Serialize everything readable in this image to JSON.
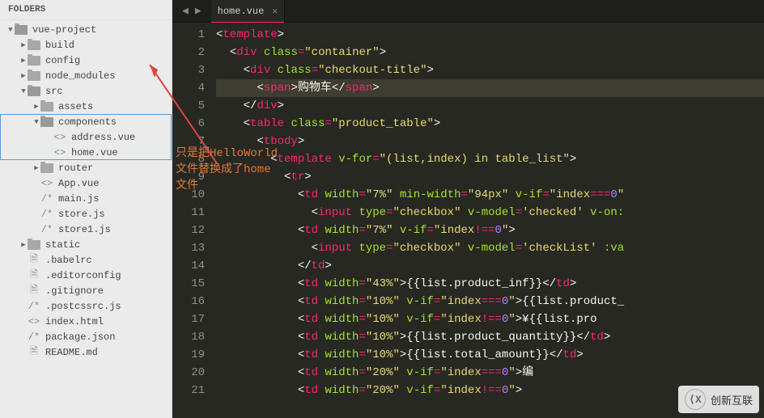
{
  "sidebar": {
    "title": "FOLDERS",
    "tree": [
      {
        "depth": 0,
        "arrow": "▼",
        "icon": "folder-open",
        "label": "vue-project"
      },
      {
        "depth": 1,
        "arrow": "▶",
        "icon": "folder",
        "label": "build"
      },
      {
        "depth": 1,
        "arrow": "▶",
        "icon": "folder",
        "label": "config"
      },
      {
        "depth": 1,
        "arrow": "▶",
        "icon": "folder",
        "label": "node_modules"
      },
      {
        "depth": 1,
        "arrow": "▼",
        "icon": "folder-open",
        "label": "src"
      },
      {
        "depth": 2,
        "arrow": "▶",
        "icon": "folder",
        "label": "assets"
      },
      {
        "depth": 2,
        "arrow": "▼",
        "icon": "folder-open",
        "label": "components",
        "hl": true
      },
      {
        "depth": 3,
        "arrow": "",
        "icon": "code",
        "label": "address.vue",
        "hl": true
      },
      {
        "depth": 3,
        "arrow": "",
        "icon": "code",
        "label": "home.vue",
        "hl": true
      },
      {
        "depth": 2,
        "arrow": "▶",
        "icon": "folder",
        "label": "router"
      },
      {
        "depth": 2,
        "arrow": "",
        "icon": "code",
        "label": "App.vue"
      },
      {
        "depth": 2,
        "arrow": "",
        "icon": "js",
        "label": "main.js"
      },
      {
        "depth": 2,
        "arrow": "",
        "icon": "js",
        "label": "store.js"
      },
      {
        "depth": 2,
        "arrow": "",
        "icon": "js",
        "label": "store1.js"
      },
      {
        "depth": 1,
        "arrow": "▶",
        "icon": "folder",
        "label": "static"
      },
      {
        "depth": 1,
        "arrow": "",
        "icon": "file",
        "label": ".babelrc"
      },
      {
        "depth": 1,
        "arrow": "",
        "icon": "file",
        "label": ".editorconfig"
      },
      {
        "depth": 1,
        "arrow": "",
        "icon": "file",
        "label": ".gitignore"
      },
      {
        "depth": 1,
        "arrow": "",
        "icon": "js",
        "label": ".postcssrc.js"
      },
      {
        "depth": 1,
        "arrow": "",
        "icon": "code",
        "label": "index.html"
      },
      {
        "depth": 1,
        "arrow": "",
        "icon": "js",
        "label": "package.json"
      },
      {
        "depth": 1,
        "arrow": "",
        "icon": "file",
        "label": "README.md"
      }
    ]
  },
  "tab": {
    "name": "home.vue"
  },
  "annotation": {
    "line1": "只是把HelloWorld",
    "line2": "文件替换成了home",
    "line3": "文件"
  },
  "code": {
    "lines": [
      [
        [
          "br",
          "<"
        ],
        [
          "tag",
          "template"
        ],
        [
          "br",
          ">"
        ]
      ],
      [
        [
          "pl",
          "  "
        ],
        [
          "br",
          "<"
        ],
        [
          "tag",
          "div"
        ],
        [
          "pl",
          " "
        ],
        [
          "attr",
          "class"
        ],
        [
          "op",
          "="
        ],
        [
          "str",
          "\"container\""
        ],
        [
          "br",
          ">"
        ]
      ],
      [
        [
          "pl",
          "    "
        ],
        [
          "br",
          "<"
        ],
        [
          "tag",
          "div"
        ],
        [
          "pl",
          " "
        ],
        [
          "attr",
          "class"
        ],
        [
          "op",
          "="
        ],
        [
          "str",
          "\"checkout-title\""
        ],
        [
          "br",
          ">"
        ]
      ],
      [
        [
          "pl",
          "      "
        ],
        [
          "br",
          "<"
        ],
        [
          "tag",
          "span"
        ],
        [
          "br",
          ">"
        ],
        [
          "pl",
          "购物车"
        ],
        [
          "br",
          "</"
        ],
        [
          "tag",
          "span"
        ],
        [
          "br",
          ">"
        ]
      ],
      [
        [
          "pl",
          "    "
        ],
        [
          "br",
          "</"
        ],
        [
          "tag",
          "div"
        ],
        [
          "br",
          ">"
        ]
      ],
      [
        [
          "pl",
          "    "
        ],
        [
          "br",
          "<"
        ],
        [
          "tag",
          "table"
        ],
        [
          "pl",
          " "
        ],
        [
          "attr",
          "class"
        ],
        [
          "op",
          "="
        ],
        [
          "str",
          "\"product_table\""
        ],
        [
          "br",
          ">"
        ]
      ],
      [
        [
          "pl",
          "      "
        ],
        [
          "br",
          "<"
        ],
        [
          "tag",
          "tbody"
        ],
        [
          "br",
          ">"
        ]
      ],
      [
        [
          "pl",
          "        "
        ],
        [
          "br",
          "<"
        ],
        [
          "tag",
          "template"
        ],
        [
          "pl",
          " "
        ],
        [
          "attr",
          "v-for"
        ],
        [
          "op",
          "="
        ],
        [
          "str",
          "\"(list,index) in table_list\""
        ],
        [
          "br",
          ">"
        ]
      ],
      [
        [
          "pl",
          "          "
        ],
        [
          "br",
          "<"
        ],
        [
          "tag",
          "tr"
        ],
        [
          "br",
          ">"
        ]
      ],
      [
        [
          "pl",
          "            "
        ],
        [
          "br",
          "<"
        ],
        [
          "tag",
          "td"
        ],
        [
          "pl",
          " "
        ],
        [
          "attr",
          "width"
        ],
        [
          "op",
          "="
        ],
        [
          "str",
          "\"7%\""
        ],
        [
          "pl",
          " "
        ],
        [
          "attr",
          "min-width"
        ],
        [
          "op",
          "="
        ],
        [
          "str",
          "\"94px\""
        ],
        [
          "pl",
          " "
        ],
        [
          "attr",
          "v-if"
        ],
        [
          "op",
          "="
        ],
        [
          "str",
          "\"index"
        ],
        [
          "op",
          "==="
        ],
        [
          "num",
          "0"
        ],
        [
          "str",
          "\""
        ]
      ],
      [
        [
          "pl",
          "              "
        ],
        [
          "br",
          "<"
        ],
        [
          "tag",
          "input"
        ],
        [
          "pl",
          " "
        ],
        [
          "attr",
          "type"
        ],
        [
          "op",
          "="
        ],
        [
          "str",
          "\"checkbox\""
        ],
        [
          "pl",
          " "
        ],
        [
          "attr",
          "v-model"
        ],
        [
          "op",
          "="
        ],
        [
          "str",
          "'checked'"
        ],
        [
          "pl",
          " "
        ],
        [
          "attr",
          "v-on:"
        ]
      ],
      [
        [
          "pl",
          "            "
        ],
        [
          "br",
          "<"
        ],
        [
          "tag",
          "td"
        ],
        [
          "pl",
          " "
        ],
        [
          "attr",
          "width"
        ],
        [
          "op",
          "="
        ],
        [
          "str",
          "\"7%\""
        ],
        [
          "pl",
          " "
        ],
        [
          "attr",
          "v-if"
        ],
        [
          "op",
          "="
        ],
        [
          "str",
          "\"index"
        ],
        [
          "op",
          "!=="
        ],
        [
          "num",
          "0"
        ],
        [
          "str",
          "\""
        ],
        [
          "br",
          ">"
        ]
      ],
      [
        [
          "pl",
          "              "
        ],
        [
          "br",
          "<"
        ],
        [
          "tag",
          "input"
        ],
        [
          "pl",
          " "
        ],
        [
          "attr",
          "type"
        ],
        [
          "op",
          "="
        ],
        [
          "str",
          "\"checkbox\""
        ],
        [
          "pl",
          " "
        ],
        [
          "attr",
          "v-model"
        ],
        [
          "op",
          "="
        ],
        [
          "str",
          "'checkList'"
        ],
        [
          "pl",
          " "
        ],
        [
          "attr",
          ":va"
        ]
      ],
      [
        [
          "pl",
          "            "
        ],
        [
          "br",
          "</"
        ],
        [
          "tag",
          "td"
        ],
        [
          "br",
          ">"
        ]
      ],
      [
        [
          "pl",
          "            "
        ],
        [
          "br",
          "<"
        ],
        [
          "tag",
          "td"
        ],
        [
          "pl",
          " "
        ],
        [
          "attr",
          "width"
        ],
        [
          "op",
          "="
        ],
        [
          "str",
          "\"43%\""
        ],
        [
          "br",
          ">"
        ],
        [
          "pl",
          "{{list.product_inf}}"
        ],
        [
          "br",
          "</"
        ],
        [
          "tag",
          "td"
        ],
        [
          "br",
          ">"
        ]
      ],
      [
        [
          "pl",
          "            "
        ],
        [
          "br",
          "<"
        ],
        [
          "tag",
          "td"
        ],
        [
          "pl",
          " "
        ],
        [
          "attr",
          "width"
        ],
        [
          "op",
          "="
        ],
        [
          "str",
          "\"10%\""
        ],
        [
          "pl",
          " "
        ],
        [
          "attr",
          "v-if"
        ],
        [
          "op",
          "="
        ],
        [
          "str",
          "\"index"
        ],
        [
          "op",
          "==="
        ],
        [
          "num",
          "0"
        ],
        [
          "str",
          "\""
        ],
        [
          "br",
          ">"
        ],
        [
          "pl",
          "{{list.product_"
        ]
      ],
      [
        [
          "pl",
          "            "
        ],
        [
          "br",
          "<"
        ],
        [
          "tag",
          "td"
        ],
        [
          "pl",
          " "
        ],
        [
          "attr",
          "width"
        ],
        [
          "op",
          "="
        ],
        [
          "str",
          "\"10%\""
        ],
        [
          "pl",
          " "
        ],
        [
          "attr",
          "v-if"
        ],
        [
          "op",
          "="
        ],
        [
          "str",
          "\"index"
        ],
        [
          "op",
          "!=="
        ],
        [
          "num",
          "0"
        ],
        [
          "str",
          "\""
        ],
        [
          "br",
          ">"
        ],
        [
          "pl",
          "&yen;{{list.pro"
        ]
      ],
      [
        [
          "pl",
          "            "
        ],
        [
          "br",
          "<"
        ],
        [
          "tag",
          "td"
        ],
        [
          "pl",
          " "
        ],
        [
          "attr",
          "width"
        ],
        [
          "op",
          "="
        ],
        [
          "str",
          "\"10%\""
        ],
        [
          "br",
          ">"
        ],
        [
          "pl",
          "{{list.product_quantity}}"
        ],
        [
          "br",
          "</"
        ],
        [
          "tag",
          "td"
        ],
        [
          "br",
          ">"
        ]
      ],
      [
        [
          "pl",
          "            "
        ],
        [
          "br",
          "<"
        ],
        [
          "tag",
          "td"
        ],
        [
          "pl",
          " "
        ],
        [
          "attr",
          "width"
        ],
        [
          "op",
          "="
        ],
        [
          "str",
          "\"10%\""
        ],
        [
          "br",
          ">"
        ],
        [
          "pl",
          "{{list.total_amount}}"
        ],
        [
          "br",
          "</"
        ],
        [
          "tag",
          "td"
        ],
        [
          "br",
          ">"
        ]
      ],
      [
        [
          "pl",
          "            "
        ],
        [
          "br",
          "<"
        ],
        [
          "tag",
          "td"
        ],
        [
          "pl",
          " "
        ],
        [
          "attr",
          "width"
        ],
        [
          "op",
          "="
        ],
        [
          "str",
          "\"20%\""
        ],
        [
          "pl",
          " "
        ],
        [
          "attr",
          "v-if"
        ],
        [
          "op",
          "="
        ],
        [
          "str",
          "\"index"
        ],
        [
          "op",
          "==="
        ],
        [
          "num",
          "0"
        ],
        [
          "str",
          "\""
        ],
        [
          "br",
          ">"
        ],
        [
          "pl",
          "编"
        ]
      ],
      [
        [
          "pl",
          "            "
        ],
        [
          "br",
          "<"
        ],
        [
          "tag",
          "td"
        ],
        [
          "pl",
          " "
        ],
        [
          "attr",
          "width"
        ],
        [
          "op",
          "="
        ],
        [
          "str",
          "\"20%\""
        ],
        [
          "pl",
          " "
        ],
        [
          "attr",
          "v-if"
        ],
        [
          "op",
          "="
        ],
        [
          "str",
          "\"index"
        ],
        [
          "op",
          "!=="
        ],
        [
          "num",
          "0"
        ],
        [
          "str",
          "\""
        ],
        [
          "br",
          ">"
        ]
      ]
    ],
    "highlight_line": 4
  },
  "logo": {
    "text": "创新互联"
  }
}
